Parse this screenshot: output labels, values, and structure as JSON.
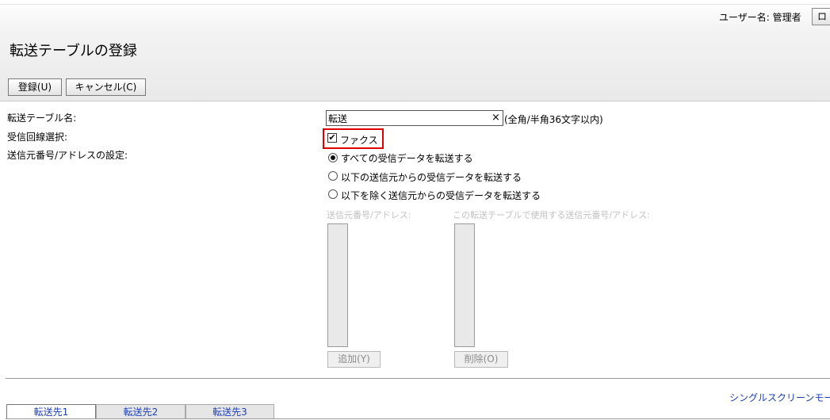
{
  "header": {
    "user_label": "ユーザー名: 管理者",
    "logout_label": "ロ",
    "page_title": "転送テーブルの登録"
  },
  "toolbar": {
    "register_label": "登録(U)",
    "cancel_label": "キャンセル(C)"
  },
  "form": {
    "table_name_label": "転送テーブル名:",
    "table_name_value": "転送",
    "table_name_clear": "×",
    "table_name_hint": "(全角/半角36文字以内)",
    "line_label": "受信回線選択:",
    "fax_checkbox_label": "ファクス",
    "fax_checked": true,
    "fax_check_mark": "✔",
    "sender_label": "送信元番号/アドレスの設定:",
    "radio_options": [
      "すべての受信データを転送する",
      "以下の送信元からの受信データを転送する",
      "以下を除く送信元からの受信データを転送する"
    ],
    "selected_radio_index": 0,
    "sender_list_label": "送信元番号/アドレス:",
    "used_list_label": "この転送テーブルで使用する送信元番号/アドレス:",
    "add_button_label": "追加(Y)",
    "delete_button_label": "削除(O)"
  },
  "footer": {
    "mode_link": "シングルスクリーンモー",
    "tabs": [
      "転送先1",
      "転送先2",
      "転送先3"
    ],
    "active_tab_index": 0
  }
}
